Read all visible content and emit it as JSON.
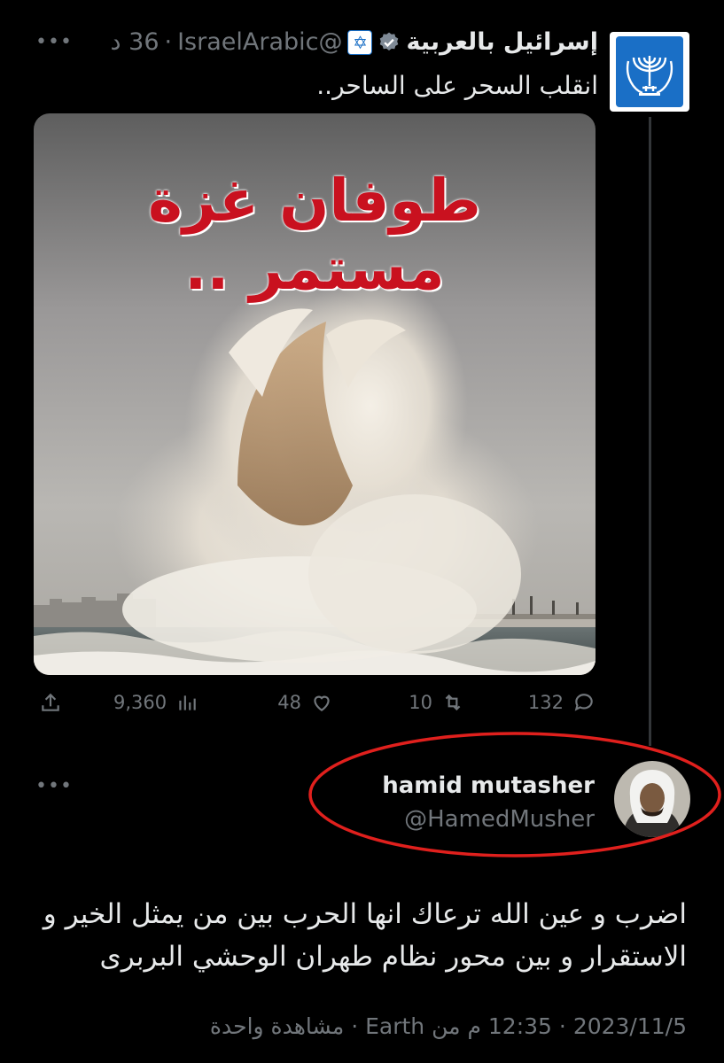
{
  "tweet": {
    "display_name": "إسرائيل بالعربية",
    "handle": "@IsraelArabic",
    "separator": "·",
    "time": "36 د",
    "text": "انقلب السحر على الساحر..",
    "image_overlay_text": "طوفان غزة مستمر ..",
    "actions": {
      "replies": "132",
      "retweets": "10",
      "likes": "48",
      "views": "9,360"
    }
  },
  "reply": {
    "display_name": "hamid mutasher",
    "handle": "@HamedMusher",
    "body_line1": "اضرب و عين الله ترعاك انها الحرب بين من يمثل الخير و",
    "body_line2": "الاستقرار و بين محور نظام طهران الوحشي البربرى",
    "meta": {
      "date": "2023/11/5",
      "time_location": "12:35 م من Earth",
      "views": "مشاهدة واحدة",
      "separator": "·"
    }
  },
  "colors": {
    "background": "#000000",
    "text_primary": "#e7e9ea",
    "text_secondary": "#71767b",
    "verified": "#1d9bf0",
    "annotation_circle": "#e0201d",
    "overlay_text": "#c9111f"
  },
  "icons": {
    "more": "more-horizontal-icon",
    "verified": "verified-badge-icon",
    "reply": "reply-icon",
    "retweet": "retweet-icon",
    "like": "heart-icon",
    "views": "views-chart-icon",
    "share": "share-icon"
  }
}
